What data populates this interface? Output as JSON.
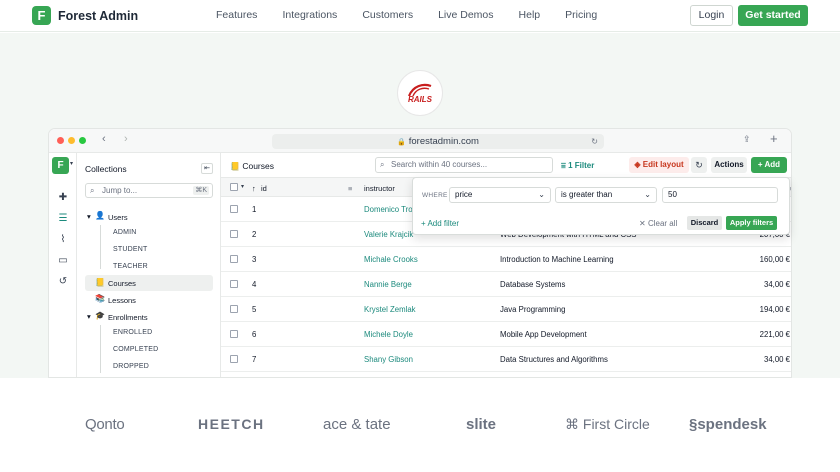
{
  "site": {
    "logo_letter": "F",
    "logo_text": "Forest Admin",
    "nav": [
      "Features",
      "Integrations",
      "Customers",
      "Live Demos",
      "Help",
      "Pricing"
    ],
    "login_label": "Login",
    "cta_label": "Get started",
    "accent": "#37a654"
  },
  "framework_badge": {
    "label": "RAILS",
    "icon": "rails-logo-icon"
  },
  "browser": {
    "url": "forestadmin.com"
  },
  "collections": {
    "title": "Collections",
    "jump_placeholder": "Jump to...",
    "jump_shortcut": "⌘K",
    "items": [
      {
        "label": "Users",
        "expanded": true,
        "subs": [
          "ADMIN",
          "STUDENT",
          "TEACHER"
        ]
      },
      {
        "label": "Courses",
        "active": true
      },
      {
        "label": "Lessons"
      },
      {
        "label": "Enrollments",
        "expanded": true,
        "subs": [
          "ENROLLED",
          "COMPLETED",
          "DROPPED"
        ]
      }
    ]
  },
  "toolbar": {
    "collection": "Courses",
    "search_placeholder": "Search within 40 courses...",
    "filter_label": "1 Filter",
    "edit_layout": "Edit layout",
    "actions": "Actions",
    "add": "Add"
  },
  "table": {
    "columns": [
      "id",
      "instructor"
    ],
    "rows": [
      {
        "id": "1",
        "instructor": "Domenico Tromp",
        "title": "",
        "price": "€"
      },
      {
        "id": "2",
        "instructor": "Valerie Krajcik",
        "title": "Web Development with HTML and CSS",
        "price": "207,00 €"
      },
      {
        "id": "3",
        "instructor": "Michale Crooks",
        "title": "Introduction to Machine Learning",
        "price": "160,00 €"
      },
      {
        "id": "4",
        "instructor": "Nannie Berge",
        "title": "Database Systems",
        "price": "34,00 €"
      },
      {
        "id": "5",
        "instructor": "Krystel Zemlak",
        "title": "Java Programming",
        "price": "194,00 €"
      },
      {
        "id": "6",
        "instructor": "Michele Doyle",
        "title": "Mobile App Development",
        "price": "221,00 €"
      },
      {
        "id": "7",
        "instructor": "Shany Gibson",
        "title": "Data Structures and Algorithms",
        "price": "34,00 €"
      }
    ]
  },
  "filter_popup": {
    "where": "WHERE",
    "field": "price",
    "operator": "is greater than",
    "value": "50",
    "add_filter": "Add filter",
    "clear_all": "Clear all",
    "discard": "Discard",
    "apply": "Apply filters"
  },
  "customer_logos": [
    "Qonto",
    "HEETCH",
    "ace & tate",
    "slite",
    "First Circle",
    "spendesk"
  ]
}
